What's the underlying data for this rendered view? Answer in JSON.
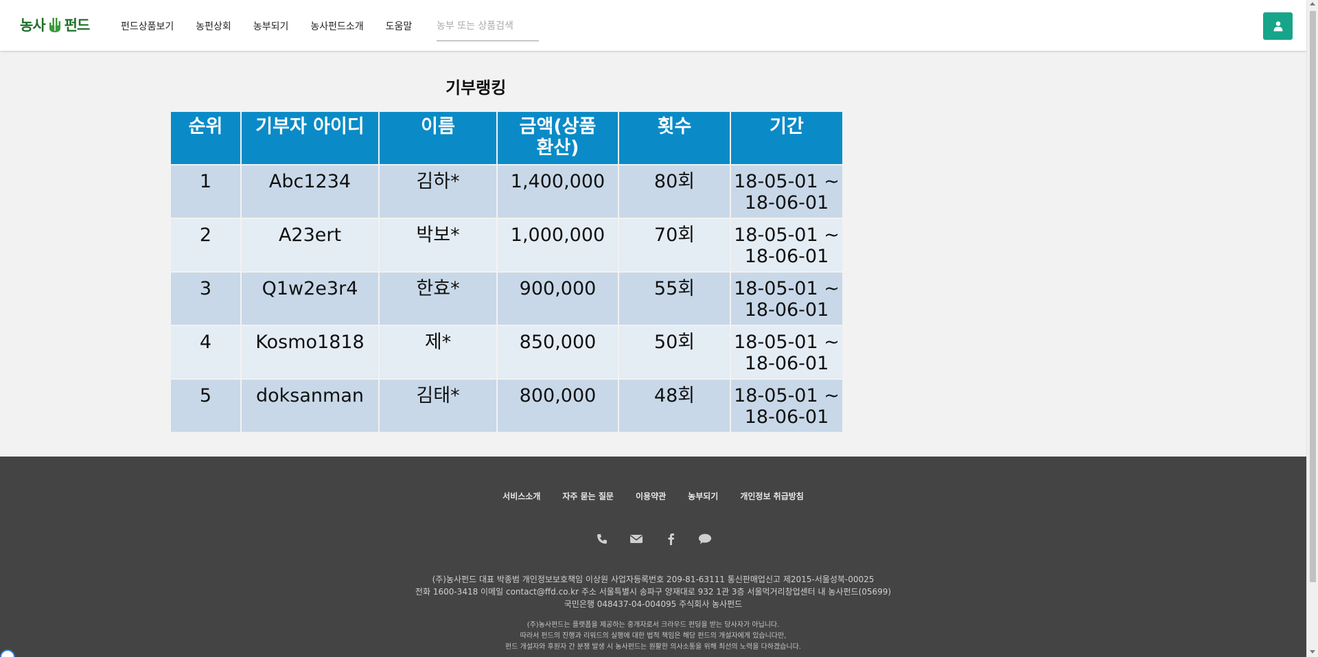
{
  "header": {
    "logo_text_left": "농사",
    "logo_text_right": "펀드",
    "nav": [
      "펀드상품보기",
      "농펀상회",
      "농부되기",
      "농사펀드소개",
      "도움말"
    ],
    "search_placeholder": "농부 또는 상품검색",
    "user_icon": "user-icon",
    "accent_color": "#17a589"
  },
  "ranking": {
    "title": "기부랭킹",
    "columns": [
      "순위",
      "기부자 아이디",
      "이름",
      "금액(상품\n환산)",
      "횟수",
      "기간"
    ],
    "rows": [
      {
        "rank": "1",
        "id": "Abc1234",
        "name": "김하*",
        "amount": "1,400,000",
        "count": "80회",
        "period": "18-05-01 ~\n18-06-01"
      },
      {
        "rank": "2",
        "id": "A23ert",
        "name": "박보*",
        "amount": "1,000,000",
        "count": "70회",
        "period": "18-05-01 ~\n18-06-01"
      },
      {
        "rank": "3",
        "id": "Q1w2e3r4",
        "name": "한효*",
        "amount": "900,000",
        "count": "55회",
        "period": "18-05-01 ~\n18-06-01"
      },
      {
        "rank": "4",
        "id": "Kosmo1818",
        "name": "제*",
        "amount": "850,000",
        "count": "50회",
        "period": "18-05-01 ~\n18-06-01"
      },
      {
        "rank": "5",
        "id": "doksanman",
        "name": "김태*",
        "amount": "800,000",
        "count": "48회",
        "period": "18-05-01 ~\n18-06-01"
      }
    ],
    "header_color": "#0a8bc7"
  },
  "footer": {
    "links": [
      "서비스소개",
      "자주 묻는 질문",
      "이용약관",
      "농부되기",
      "개인정보 취급방침"
    ],
    "icons": [
      "phone-icon",
      "envelope-icon",
      "facebook-icon",
      "chat-icon"
    ],
    "info_lines": [
      "(주)농사펀드 대표 박종범 개인정보보호책임 이상원 사업자등록번호 209-81-63111 통신판매업신고 제2015-서울성북-00025",
      "전화 1600-3418 이메일 contact@ffd.co.kr 주소 서울특별시 송파구 양재대로 932 1관 3층 서울먹거리창업센터 내 농사펀드(05699)",
      "국민은행 048437-04-004095 주식회사 농사펀드"
    ],
    "note_lines": [
      "(주)농사펀드는 플랫폼을 제공하는 중개자로서 크라우드 펀딩을 받는 당사자가 아닙니다.",
      "따라서 펀드의 진행과 리워드의 실행에 대한 법적 책임은 해당 펀드의 개설자에게 있습니다만,",
      "펀드 개설자와 후원자 간 분쟁 발생 시 농사펀드는 원활한 의사소통을 위해 최선의 노력을 다하겠습니다."
    ]
  }
}
